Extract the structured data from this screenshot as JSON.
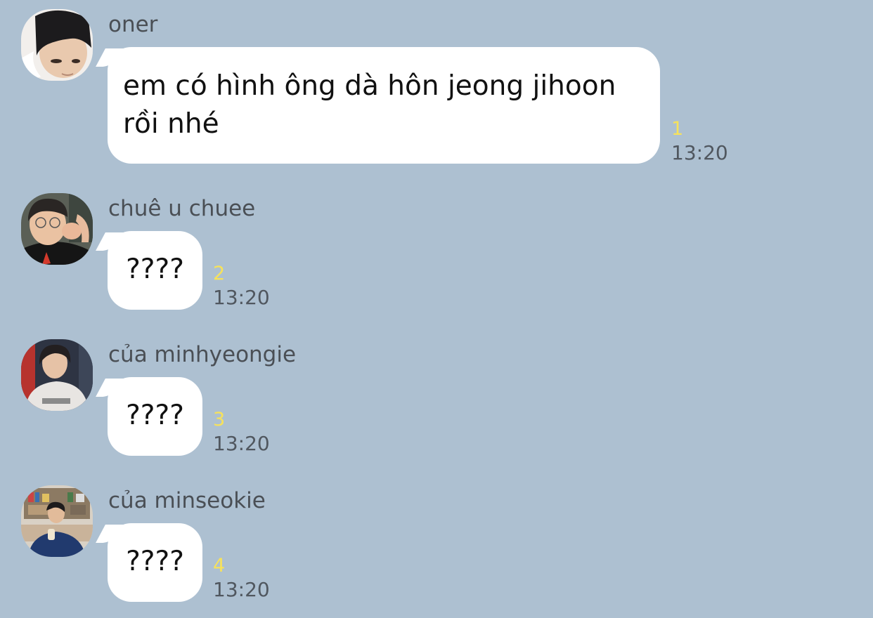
{
  "messages": [
    {
      "sender": "oner",
      "text": "em có hình ông dà hôn jeong jihoon\nrồi nhé",
      "unread_count": "1",
      "time": "13:20"
    },
    {
      "sender": "chuê u chuee",
      "text": "????",
      "unread_count": "2",
      "time": "13:20"
    },
    {
      "sender": "của minhyeongie",
      "text": "????",
      "unread_count": "3",
      "time": "13:20"
    },
    {
      "sender": "của minseokie",
      "text": "????",
      "unread_count": "4",
      "time": "13:20"
    }
  ],
  "colors": {
    "background": "#adc0d1",
    "bubble": "#ffffff",
    "unread": "#f7e25a",
    "time": "#50575f",
    "sender": "#4a4f55"
  }
}
